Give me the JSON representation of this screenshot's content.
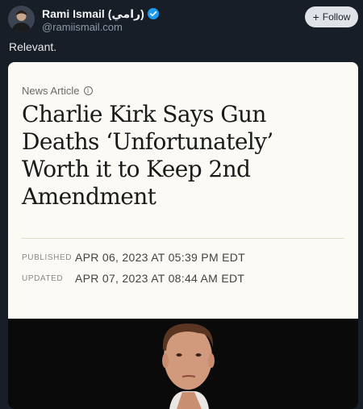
{
  "author": {
    "name": "Rami Ismail (رامي)",
    "handle": "@ramiismail.com",
    "avatar_icon": "person-avatar"
  },
  "follow_button": {
    "label": "Follow",
    "icon": "plus-icon"
  },
  "post": {
    "text": "Relevant."
  },
  "article": {
    "kicker": "News Article",
    "kicker_icon": "info-icon",
    "headline": "Charlie Kirk Says Gun Deaths ‘Unfortunately’ Worth it to Keep 2nd Amendment",
    "published_label": "PUBLISHED",
    "published_value": "APR 06, 2023 AT 05:39 PM EDT",
    "updated_label": "UPDATED",
    "updated_value": "APR 07, 2023 AT 08:44 AM EDT",
    "image_icon": "article-photo"
  },
  "colors": {
    "background": "#171e28",
    "card": "#fbfaf4",
    "verified": "#1d9bf0",
    "follow_bg": "#dfe3e7"
  }
}
